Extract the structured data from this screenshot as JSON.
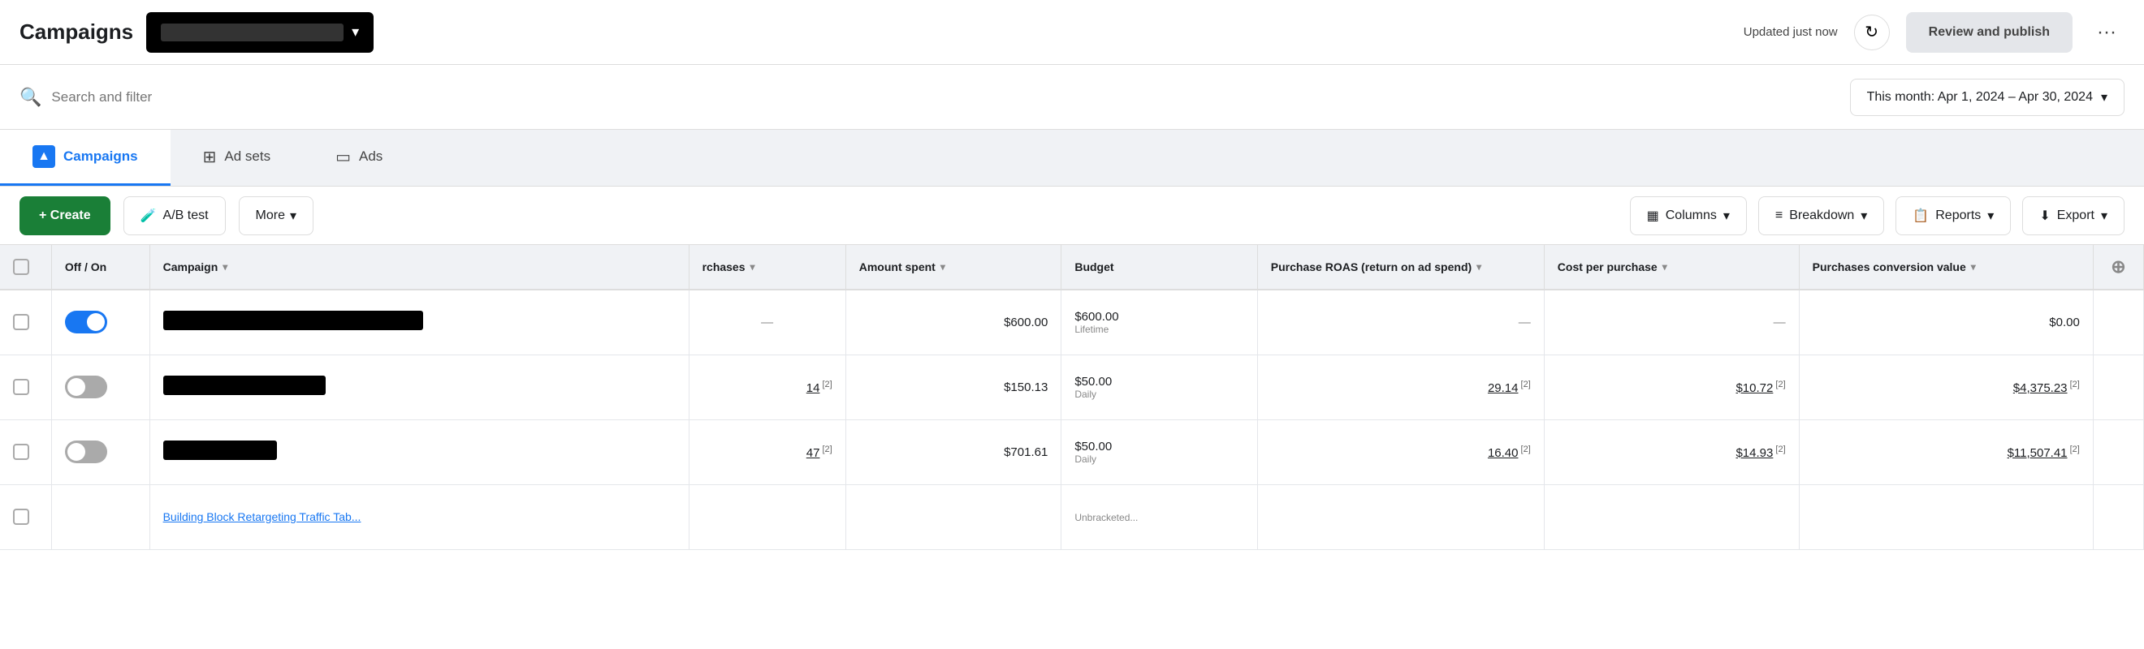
{
  "topbar": {
    "title": "Campaigns",
    "dropdown_placeholder": "",
    "updated_text": "Updated just now",
    "review_btn": "Review and publish",
    "more_dots": "···"
  },
  "searchbar": {
    "placeholder": "Search and filter",
    "date_range": "This month: Apr 1, 2024 – Apr 30, 2024"
  },
  "tabs": [
    {
      "label": "Campaigns",
      "icon": "▲",
      "active": true
    },
    {
      "label": "Ad sets",
      "icon": "⊞",
      "active": false
    },
    {
      "label": "Ads",
      "icon": "▭",
      "active": false
    }
  ],
  "actions": {
    "create": "+ Create",
    "ab_test": "A/B test",
    "more": "More",
    "columns": "Columns",
    "breakdown": "Breakdown",
    "reports": "Reports",
    "export": "Export"
  },
  "table": {
    "headers": [
      {
        "label": "",
        "key": "checkbox"
      },
      {
        "label": "Off / On",
        "key": "toggle"
      },
      {
        "label": "Campaign",
        "key": "campaign",
        "sortable": true
      },
      {
        "label": "rchases",
        "key": "purchases",
        "sortable": true
      },
      {
        "label": "Amount spent",
        "key": "amount_spent",
        "sortable": true
      },
      {
        "label": "Budget",
        "key": "budget"
      },
      {
        "label": "Purchase ROAS (return on ad spend)",
        "key": "roas",
        "sortable": true
      },
      {
        "label": "Cost per purchase",
        "key": "cost_per_purchase",
        "sortable": true
      },
      {
        "label": "Purchases conversion value",
        "key": "purchases_conversion_value",
        "sortable": true
      }
    ],
    "rows": [
      {
        "toggle": "on",
        "campaign_width": 320,
        "purchases": "—",
        "amount_spent": "$600.00",
        "budget": "$600.00",
        "budget_type": "Lifetime",
        "roas": "—",
        "cost_per_purchase": "—",
        "pcv": "$0.00"
      },
      {
        "toggle": "off",
        "campaign_width": 200,
        "purchases": "14",
        "purchases_sup": "[2]",
        "amount_spent": "$150.13",
        "budget": "$50.00",
        "budget_type": "Daily",
        "roas": "29.14",
        "roas_sup": "[2]",
        "cost_per_purchase": "$10.72",
        "cpp_sup": "[2]",
        "pcv": "$4,375.23",
        "pcv_sup": "[2]"
      },
      {
        "toggle": "off",
        "campaign_width": 140,
        "purchases": "47",
        "purchases_sup": "[2]",
        "amount_spent": "$701.61",
        "budget": "$50.00",
        "budget_type": "Daily",
        "roas": "16.40",
        "roas_sup": "[2]",
        "cost_per_purchase": "$14.93",
        "cpp_sup": "[2]",
        "pcv": "$11,507.41",
        "pcv_sup": "[2]"
      }
    ]
  }
}
